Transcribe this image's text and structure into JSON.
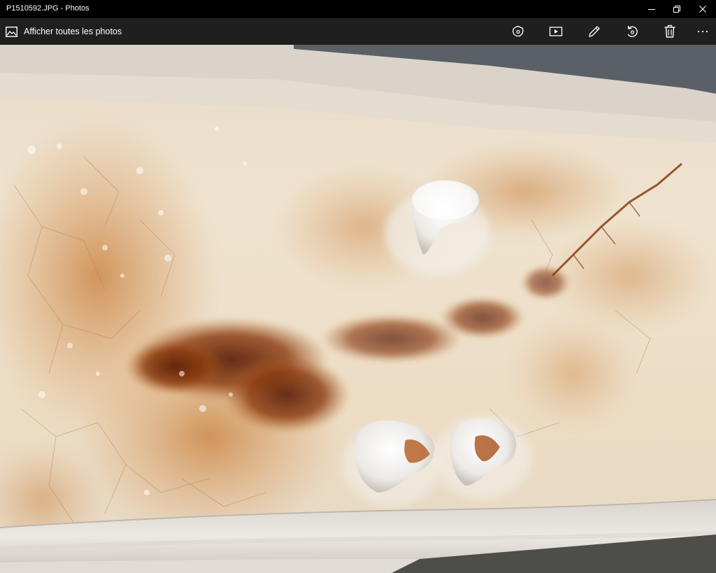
{
  "window": {
    "title": "P1510592.JPG - Photos"
  },
  "toolbar": {
    "back_label": "Afficher toutes les photos",
    "icons": [
      "enhance-icon",
      "slideshow-icon",
      "edit-icon",
      "rotate-icon",
      "delete-icon",
      "more-icon"
    ]
  },
  "photo": {
    "subject": "rusty cracked white enamel gutter with three white nodules"
  },
  "colors": {
    "titlebar_bg": "#000000",
    "toolbar_bg": "#1f1f1f",
    "icon": "#ffffff",
    "rust_dark": "#6b2a0c",
    "rust_mid": "#b8621f",
    "enamel": "#efe6d6"
  }
}
